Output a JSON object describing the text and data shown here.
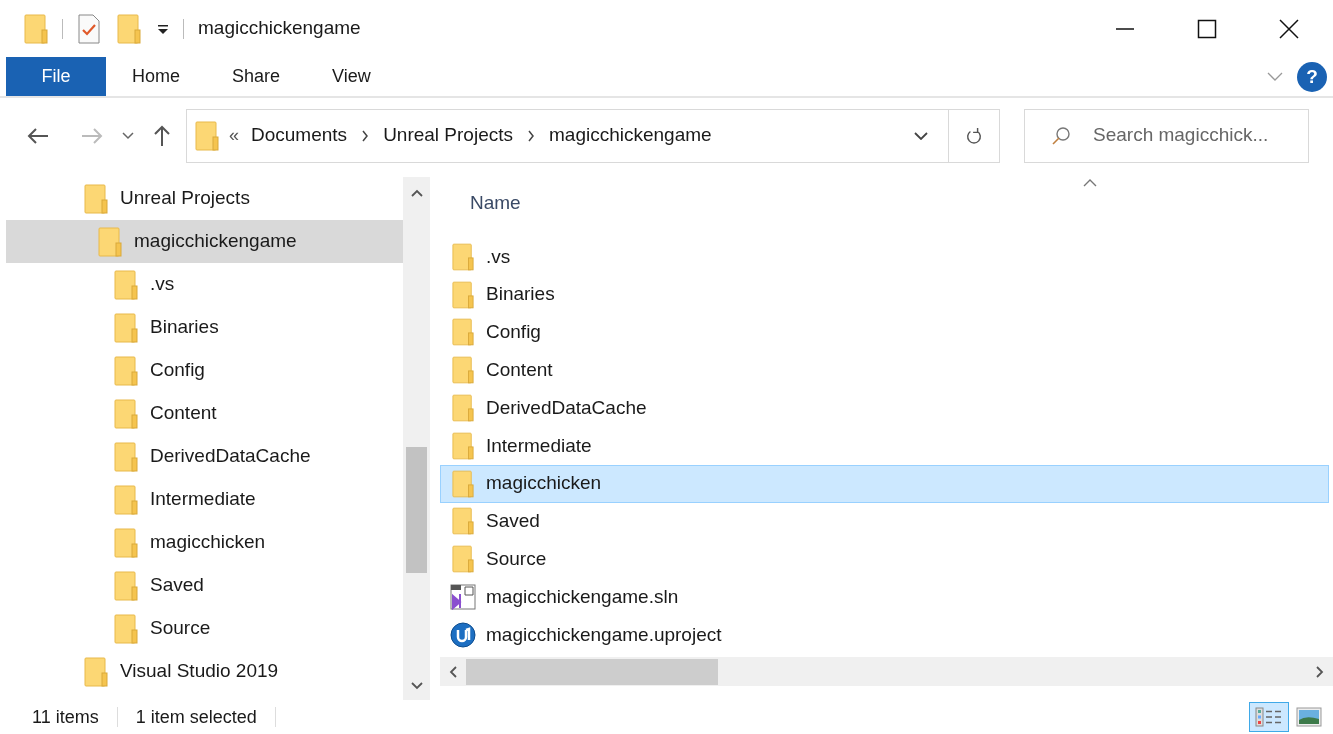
{
  "window": {
    "title": "magicchickengame"
  },
  "ribbon": {
    "tabs": [
      {
        "label": "File",
        "kind": "file"
      },
      {
        "label": "Home",
        "kind": "tab"
      },
      {
        "label": "Share",
        "kind": "tab"
      },
      {
        "label": "View",
        "kind": "tab"
      }
    ],
    "help": "?"
  },
  "address": {
    "overflow": "«",
    "path": [
      "Documents",
      "Unreal Projects",
      "magicchickengame"
    ]
  },
  "search": {
    "placeholder": "Search magicchick..."
  },
  "tree": [
    {
      "label": "Unreal Projects",
      "selected": false,
      "children": [
        {
          "label": "magicchickengame",
          "selected": true,
          "children": [
            {
              "label": ".vs",
              "selected": false
            },
            {
              "label": "Binaries",
              "selected": false
            },
            {
              "label": "Config",
              "selected": false
            },
            {
              "label": "Content",
              "selected": false
            },
            {
              "label": "DerivedDataCache",
              "selected": false
            },
            {
              "label": "Intermediate",
              "selected": false
            },
            {
              "label": "magicchicken",
              "selected": false
            },
            {
              "label": "Saved",
              "selected": false
            },
            {
              "label": "Source",
              "selected": false
            }
          ]
        }
      ]
    },
    {
      "label": "Visual Studio 2019",
      "selected": false
    }
  ],
  "files": {
    "columns": [
      "Name"
    ],
    "rows": [
      {
        "name": ".vs",
        "kind": "folder",
        "selected": false
      },
      {
        "name": "Binaries",
        "kind": "folder",
        "selected": false
      },
      {
        "name": "Config",
        "kind": "folder",
        "selected": false
      },
      {
        "name": "Content",
        "kind": "folder",
        "selected": false
      },
      {
        "name": "DerivedDataCache",
        "kind": "folder",
        "selected": false
      },
      {
        "name": "Intermediate",
        "kind": "folder",
        "selected": false
      },
      {
        "name": "magicchicken",
        "kind": "folder",
        "selected": true
      },
      {
        "name": "Saved",
        "kind": "folder",
        "selected": false
      },
      {
        "name": "Source",
        "kind": "folder",
        "selected": false
      },
      {
        "name": "magicchickengame.sln",
        "kind": "sln",
        "selected": false
      },
      {
        "name": "magicchickengame.uproject",
        "kind": "uproject",
        "selected": false
      }
    ]
  },
  "status_bar": {
    "count": "11 items",
    "selection": "1 item selected",
    "views": [
      {
        "kind": "details",
        "selected": true
      },
      {
        "kind": "large",
        "selected": false
      }
    ]
  }
}
